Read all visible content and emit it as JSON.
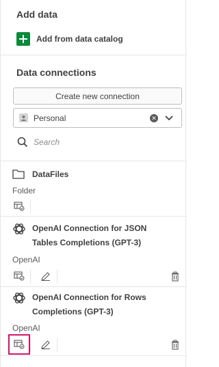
{
  "add_data": {
    "title": "Add data",
    "catalog_label": "Add from data catalog"
  },
  "data_connections": {
    "title": "Data connections",
    "create_label": "Create new connection",
    "space_value": "Personal",
    "search_placeholder": "Search"
  },
  "items": [
    {
      "title": "DataFiles",
      "subtitle": "Folder"
    },
    {
      "title_line1": "OpenAI Connection for JSON",
      "title_line2": "Tables Completions (GPT-3)",
      "subtitle": "OpenAI"
    },
    {
      "title_line1": "OpenAI Connection for Rows",
      "title_line2": "Completions (GPT-3)",
      "subtitle": "OpenAI"
    }
  ],
  "colors": {
    "accent_green": "#0a8a3a",
    "highlight": "#d1156b"
  }
}
